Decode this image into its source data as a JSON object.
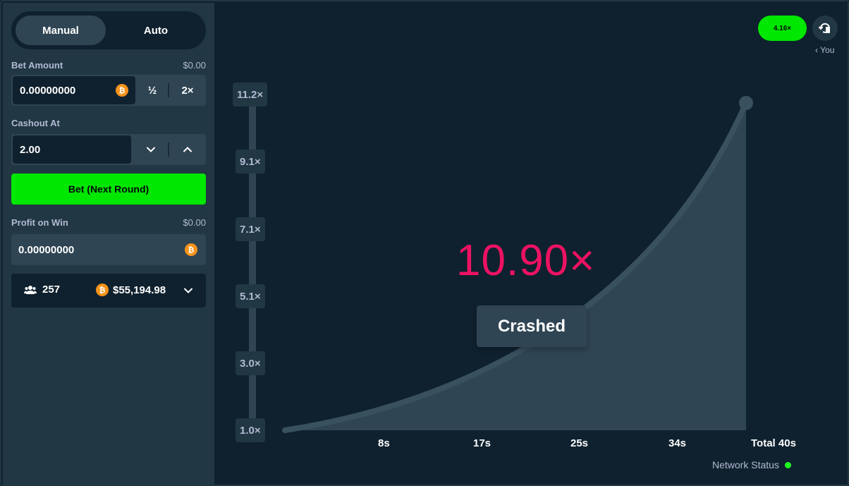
{
  "sidebar": {
    "modes": {
      "manual": "Manual",
      "auto": "Auto"
    },
    "bet_amount": {
      "label": "Bet Amount",
      "usd": "$0.00",
      "value": "0.00000000",
      "half": "½",
      "double": "2×",
      "currency_icon": "bitcoin-icon"
    },
    "cashout": {
      "label": "Cashout At",
      "value": "2.00"
    },
    "bet_button": "Bet (Next Round)",
    "profit": {
      "label": "Profit on Win",
      "usd": "$0.00",
      "value": "0.00000000"
    },
    "players": {
      "count": "257",
      "total": "$55,194.98"
    }
  },
  "game": {
    "last_result": "4.16×",
    "you_label": "‹ You",
    "multiplier": "10.90×",
    "status": "Crashed",
    "y_ticks": [
      "11.2×",
      "9.1×",
      "7.1×",
      "5.1×",
      "3.0×",
      "1.0×"
    ],
    "x_ticks": [
      "8s",
      "17s",
      "25s",
      "34s",
      "Total 40s"
    ],
    "network_status": "Network Status"
  },
  "colors": {
    "accent_green": "#00e701",
    "crash_red": "#ed1263",
    "panel": "#213743",
    "background": "#0f212e"
  }
}
